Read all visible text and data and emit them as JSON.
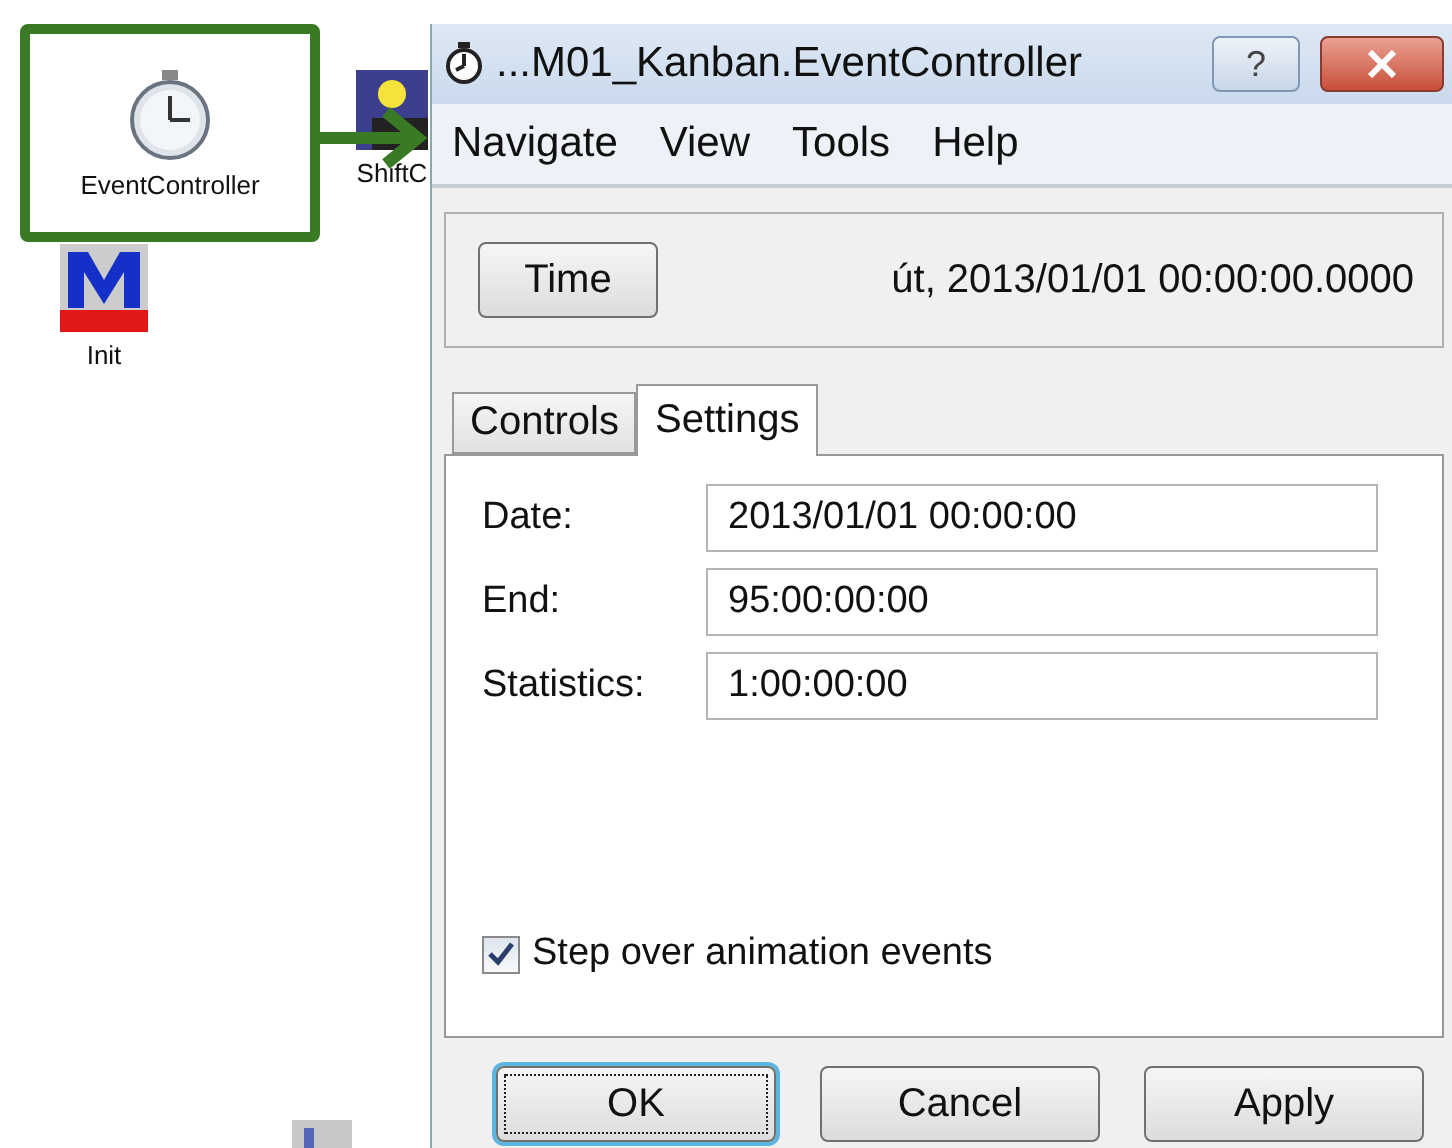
{
  "canvas": {
    "icons": [
      {
        "kind": "stopwatch",
        "label": "EventController",
        "highlighted": true
      },
      {
        "kind": "shift",
        "label": "ShiftC",
        "highlighted": false
      },
      {
        "kind": "init",
        "label": "Init",
        "highlighted": false
      },
      {
        "kind": "partial",
        "highlighted": false
      }
    ]
  },
  "window": {
    "title": "...M01_Kanban.EventController",
    "help_button": "?"
  },
  "menu": [
    "Navigate",
    "View",
    "Tools",
    "Help"
  ],
  "time_bar": {
    "button": "Time",
    "value": "út, 2013/01/01 00:00:00.0000"
  },
  "tabs": [
    {
      "label": "Controls",
      "selected": false
    },
    {
      "label": "Settings",
      "selected": true
    }
  ],
  "fields": [
    {
      "label": "Date:",
      "value": "2013/01/01 00:00:00"
    },
    {
      "label": "End:",
      "value": "95:00:00:00"
    },
    {
      "label": "Statistics:",
      "value": "1:00:00:00"
    }
  ],
  "checkbox": {
    "label": "Step over animation events",
    "checked": true
  },
  "buttons": [
    {
      "label": "OK",
      "focused": true
    },
    {
      "label": "Cancel",
      "focused": false
    },
    {
      "label": "Apply",
      "focused": false
    }
  ]
}
